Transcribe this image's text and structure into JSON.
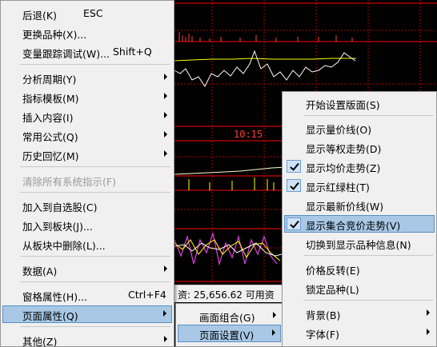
{
  "chart": {
    "time_label": "10:15",
    "status_text": "资: 25,656.62   可用资",
    "colors": {
      "background": "#000000",
      "grid": "#aa0000",
      "highlight_line": "#ff0000",
      "price": "#ffffff",
      "avg": "#ffff00",
      "kline_magenta": "#e040e0"
    }
  },
  "main_menu": {
    "items": [
      {
        "label": "后退(K)",
        "shortcut": "ESC"
      },
      {
        "label": "更换品种(X)..."
      },
      {
        "label": "变量跟踪调试(W)...",
        "shortcut": "Shift+Q"
      },
      {
        "label": "分析周期(Y)"
      },
      {
        "label": "指标模板(M)"
      },
      {
        "label": "插入内容(I)"
      },
      {
        "label": "常用公式(Q)"
      },
      {
        "label": "历史回忆(M)"
      },
      {
        "label": "清除所有系统指示(F)"
      },
      {
        "label": "加入到自选股(C)"
      },
      {
        "label": "加入到板块(J)..."
      },
      {
        "label": "从板块中删除(L)..."
      },
      {
        "label": "数据(A)"
      },
      {
        "label": "窗格属性(H)...",
        "shortcut": "Ctrl+F4"
      },
      {
        "label": "页面属性(Q)"
      },
      {
        "label": "其他(Z)"
      }
    ]
  },
  "sub_menu_1": {
    "items": [
      {
        "label": "画面组合(G)"
      },
      {
        "label": "页面设置(V)"
      }
    ]
  },
  "sub_menu_2": {
    "items": [
      {
        "label": "开始设置版面(S)"
      },
      {
        "label": "显示量价线(O)"
      },
      {
        "label": "显示等权走势(D)"
      },
      {
        "label": "显示均价走势(Z)",
        "checked": true
      },
      {
        "label": "显示红绿柱(T)",
        "checked": true
      },
      {
        "label": "显示最新价线(W)"
      },
      {
        "label": "显示集合竞价走势(V)",
        "checked": true
      },
      {
        "label": "切换到显示品种信息(N)"
      },
      {
        "label": "价格反转(E)"
      },
      {
        "label": "锁定品种(L)"
      },
      {
        "label": "背景(B)"
      },
      {
        "label": "字体(F)"
      }
    ]
  }
}
